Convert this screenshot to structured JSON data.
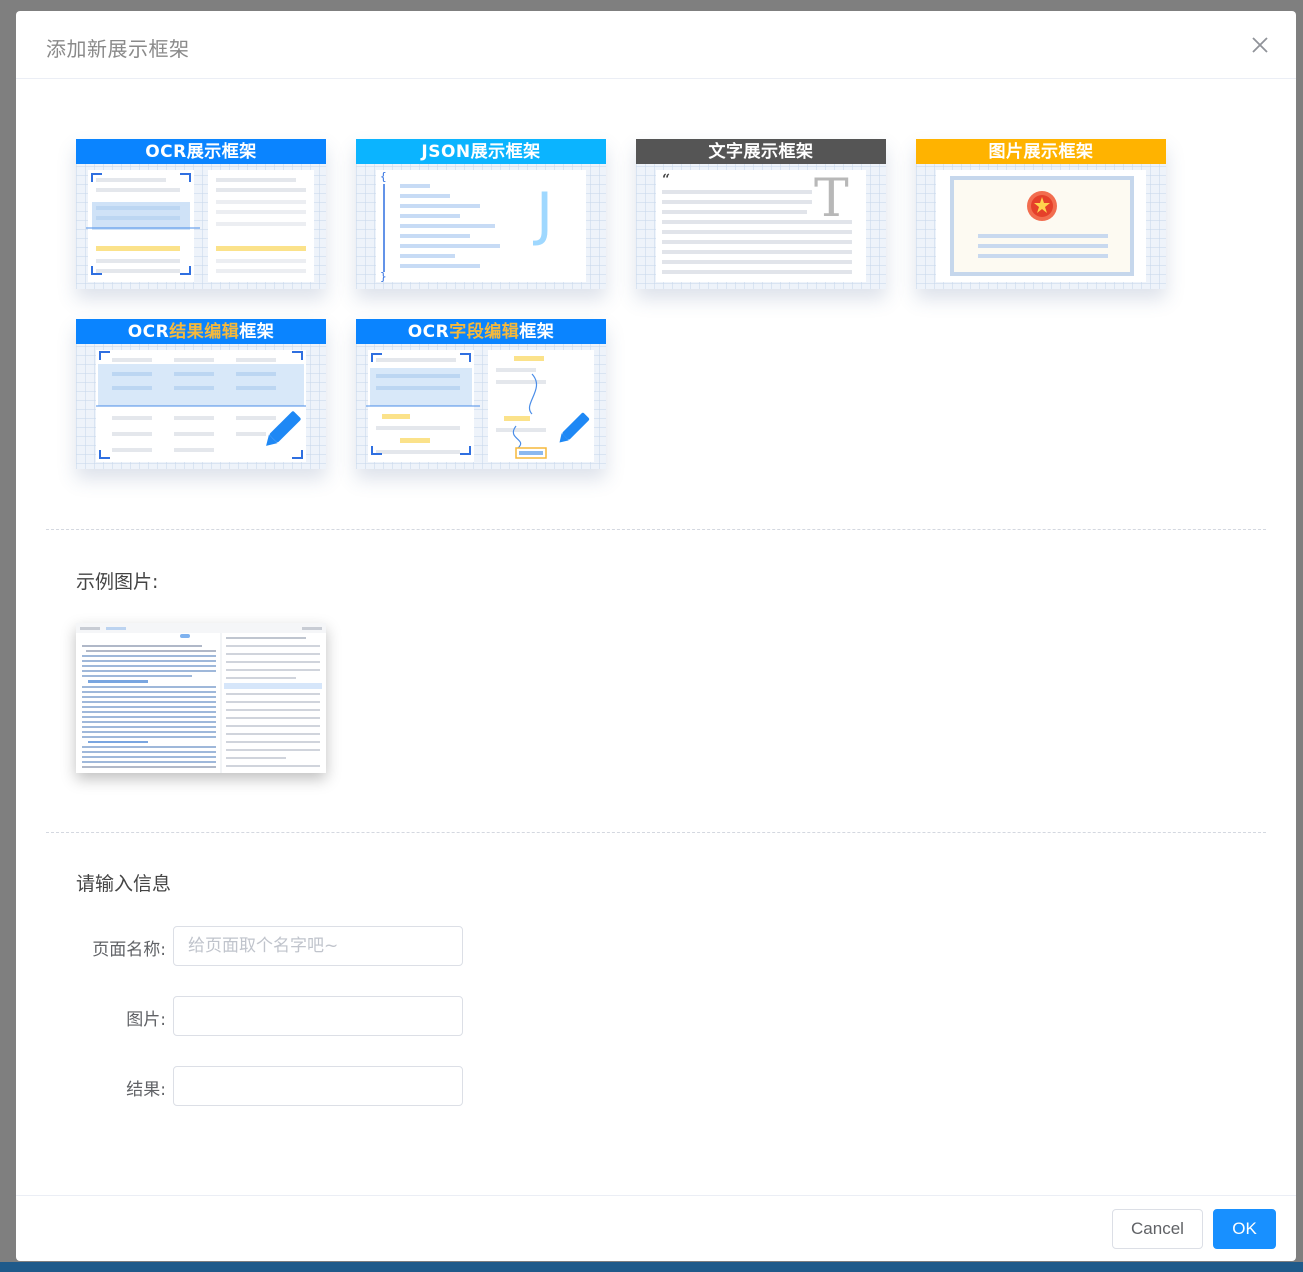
{
  "modal": {
    "title": "添加新展示框架",
    "close_icon": "close-icon"
  },
  "frames": [
    {
      "id": "ocr",
      "title_parts": [
        "OCR展示框架"
      ],
      "color": "#0a84ff"
    },
    {
      "id": "json",
      "title_parts": [
        "JSON展示框架"
      ],
      "color": "#0bb4ff"
    },
    {
      "id": "text",
      "title_parts": [
        "文字展示框架"
      ],
      "color": "#555555"
    },
    {
      "id": "image",
      "title_parts": [
        "图片展示框架"
      ],
      "color": "#ffb300"
    },
    {
      "id": "ocr-result-edit",
      "title_parts": [
        "OCR",
        "结果编辑",
        "框架"
      ],
      "color": "#0a84ff"
    },
    {
      "id": "ocr-field-edit",
      "title_parts": [
        "OCR",
        "字段编辑",
        "框架"
      ],
      "color": "#0a84ff"
    }
  ],
  "sample": {
    "title": "示例图片:"
  },
  "form": {
    "title": "请输入信息",
    "fields": [
      {
        "label": "页面名称:",
        "value": "",
        "placeholder": "给页面取个名字吧~"
      },
      {
        "label": "图片:",
        "value": "",
        "placeholder": ""
      },
      {
        "label": "结果:",
        "value": "",
        "placeholder": ""
      }
    ]
  },
  "footer": {
    "cancel_label": "Cancel",
    "ok_label": "OK"
  },
  "colors": {
    "primary": "#1890ff",
    "highlight": "#f6b93b"
  }
}
